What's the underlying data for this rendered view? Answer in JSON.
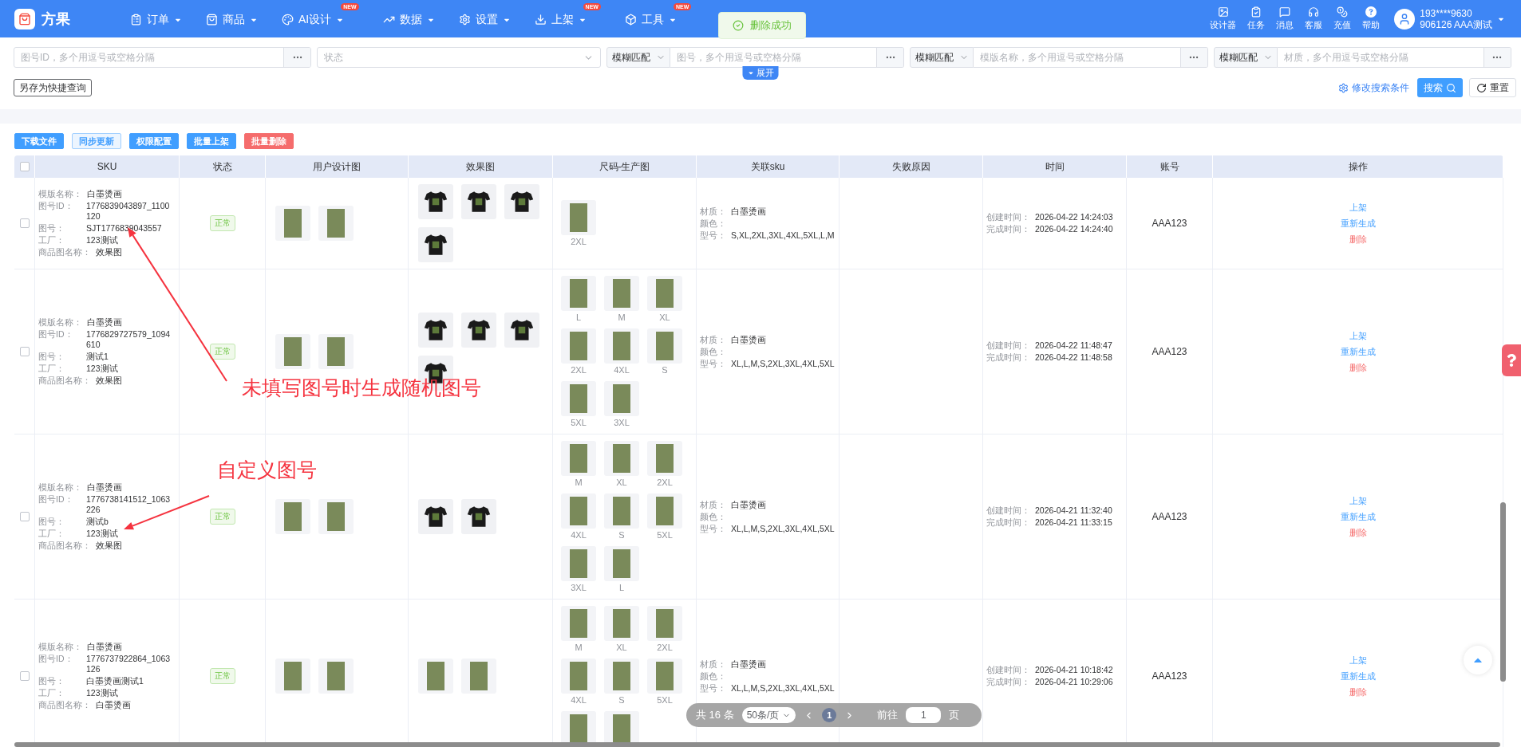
{
  "nav": {
    "logo": "方果",
    "menus": [
      {
        "label": "订单"
      },
      {
        "label": "商品"
      },
      {
        "label": "AI设计",
        "badge": "NEW"
      },
      {
        "label": "数据"
      },
      {
        "label": "设置"
      },
      {
        "label": "上架",
        "badge": "NEW"
      },
      {
        "label": "工具",
        "badge": "NEW"
      }
    ],
    "tools": [
      {
        "label": "设计器"
      },
      {
        "label": "任务"
      },
      {
        "label": "消息"
      },
      {
        "label": "客服"
      },
      {
        "label": "充值"
      },
      {
        "label": "帮助"
      }
    ],
    "user": {
      "phone": "193****9630",
      "account": "906126 AAA测试"
    }
  },
  "toast": {
    "text": "删除成功"
  },
  "filters": {
    "id_field": {
      "placeholder": "图号ID，多个用逗号或空格分隔"
    },
    "status_select": {
      "placeholder": "状态"
    },
    "groups": [
      {
        "mode": "模糊匹配",
        "placeholder": "图号，多个用逗号或空格分隔"
      },
      {
        "mode": "模糊匹配",
        "placeholder": "模版名称，多个用逗号或空格分隔"
      },
      {
        "mode": "模糊匹配",
        "placeholder": "材质，多个用逗号或空格分隔"
      }
    ],
    "save_query": "另存为快捷查询",
    "expand": "展开",
    "edit_conditions": "修改搜索条件",
    "search": "搜索",
    "reset": "重置"
  },
  "actions": [
    {
      "label": "下载文件",
      "kind": "primary"
    },
    {
      "label": "同步更新",
      "kind": "plain"
    },
    {
      "label": "权限配置",
      "kind": "primary"
    },
    {
      "label": "批量上架",
      "kind": "primary"
    },
    {
      "label": "批量删除",
      "kind": "danger"
    }
  ],
  "table": {
    "select_all": {
      "checked": false
    },
    "columns": [
      "SKU",
      "状态",
      "用户设计图",
      "效果图",
      "尺码-生产图",
      "关联sku",
      "失败原因",
      "时间",
      "账号",
      "操作"
    ],
    "rows": [
      {
        "checked": false,
        "sku": [
          {
            "label": "模版名称：",
            "value": "白墨烫画"
          },
          {
            "label": "图号ID：",
            "value": "1776839043897_1100120"
          },
          {
            "label": "图号：",
            "value": "SJT1776839043557"
          },
          {
            "label": "工厂：",
            "value": "123测试"
          },
          {
            "label": "商品图名称：",
            "value": "效果图"
          }
        ],
        "status": "正常",
        "design_images": [
          {
            "kind": "photo"
          },
          {
            "kind": "photo"
          }
        ],
        "effect_images": [
          {
            "kind": "tshirt"
          },
          {
            "kind": "tshirt"
          },
          {
            "kind": "tshirt"
          },
          {
            "kind": "tshirt"
          }
        ],
        "size_images": [
          {
            "kind": "photo",
            "label": "2XL"
          }
        ],
        "related": [
          {
            "label": "材质：",
            "value": "白墨烫画"
          },
          {
            "label": "颜色："
          },
          {
            "label": "型号：",
            "value": "S,XL,2XL,3XL,4XL,5XL,L,M"
          }
        ],
        "times": [
          {
            "label": "创建时间：",
            "value": "2026-04-22 14:24:03"
          },
          {
            "label": "完成时间：",
            "value": "2026-04-22 14:24:40"
          }
        ],
        "account": "AAA123",
        "ops": [
          {
            "label": "上架",
            "kind": "link"
          },
          {
            "label": "重新生成",
            "kind": "link"
          },
          {
            "label": "删除",
            "kind": "danger"
          }
        ]
      },
      {
        "checked": false,
        "sku": [
          {
            "label": "模版名称：",
            "value": "白墨烫画"
          },
          {
            "label": "图号ID：",
            "value": "1776829727579_1094610"
          },
          {
            "label": "图号：",
            "value": "测试1"
          },
          {
            "label": "工厂：",
            "value": "123测试"
          },
          {
            "label": "商品图名称：",
            "value": "效果图"
          }
        ],
        "status": "正常",
        "design_images": [
          {
            "kind": "photo"
          },
          {
            "kind": "photo"
          }
        ],
        "effect_images": [
          {
            "kind": "tshirt"
          },
          {
            "kind": "tshirt"
          },
          {
            "kind": "tshirt"
          },
          {
            "kind": "tshirt"
          }
        ],
        "size_images": [
          {
            "kind": "photo",
            "label": "L"
          },
          {
            "kind": "photo",
            "label": "M"
          },
          {
            "kind": "photo",
            "label": "XL"
          },
          {
            "kind": "photo",
            "label": "2XL"
          },
          {
            "kind": "photo",
            "label": "4XL"
          },
          {
            "kind": "photo",
            "label": "S"
          },
          {
            "kind": "photo",
            "label": "5XL"
          },
          {
            "kind": "photo",
            "label": "3XL"
          }
        ],
        "related": [
          {
            "label": "材质：",
            "value": "白墨烫画"
          },
          {
            "label": "颜色："
          },
          {
            "label": "型号：",
            "value": "XL,L,M,S,2XL,3XL,4XL,5XL"
          }
        ],
        "times": [
          {
            "label": "创建时间：",
            "value": "2026-04-22 11:48:47"
          },
          {
            "label": "完成时间：",
            "value": "2026-04-22 11:48:58"
          }
        ],
        "account": "AAA123",
        "ops": [
          {
            "label": "上架",
            "kind": "link"
          },
          {
            "label": "重新生成",
            "kind": "link"
          },
          {
            "label": "删除",
            "kind": "danger"
          }
        ]
      },
      {
        "checked": false,
        "sku": [
          {
            "label": "模版名称：",
            "value": "白墨烫画"
          },
          {
            "label": "图号ID：",
            "value": "1776738141512_1063226"
          },
          {
            "label": "图号：",
            "value": "测试b"
          },
          {
            "label": "工厂：",
            "value": "123测试"
          },
          {
            "label": "商品图名称：",
            "value": "效果图"
          }
        ],
        "status": "正常",
        "design_images": [
          {
            "kind": "photo"
          },
          {
            "kind": "photo"
          }
        ],
        "effect_images": [
          {
            "kind": "tshirt"
          },
          {
            "kind": "tshirt"
          }
        ],
        "size_images": [
          {
            "kind": "photo",
            "label": "M"
          },
          {
            "kind": "photo",
            "label": "XL"
          },
          {
            "kind": "photo",
            "label": "2XL"
          },
          {
            "kind": "photo",
            "label": "4XL"
          },
          {
            "kind": "photo",
            "label": "S"
          },
          {
            "kind": "photo",
            "label": "5XL"
          },
          {
            "kind": "photo",
            "label": "3XL"
          },
          {
            "kind": "photo",
            "label": "L"
          }
        ],
        "related": [
          {
            "label": "材质：",
            "value": "白墨烫画"
          },
          {
            "label": "颜色："
          },
          {
            "label": "型号：",
            "value": "XL,L,M,S,2XL,3XL,4XL,5XL"
          }
        ],
        "times": [
          {
            "label": "创建时间：",
            "value": "2026-04-21 11:32:40"
          },
          {
            "label": "完成时间：",
            "value": "2026-04-21 11:33:15"
          }
        ],
        "account": "AAA123",
        "ops": [
          {
            "label": "上架",
            "kind": "link"
          },
          {
            "label": "重新生成",
            "kind": "link"
          },
          {
            "label": "删除",
            "kind": "danger"
          }
        ]
      },
      {
        "checked": false,
        "sku": [
          {
            "label": "模版名称：",
            "value": "白墨烫画"
          },
          {
            "label": "图号ID：",
            "value": "1776737922864_1063126"
          },
          {
            "label": "图号：",
            "value": "白墨烫画测试1"
          },
          {
            "label": "工厂：",
            "value": "123测试"
          },
          {
            "label": "商品图名称：",
            "value": "白墨烫画"
          }
        ],
        "status": "正常",
        "design_images": [
          {
            "kind": "photo"
          },
          {
            "kind": "photo"
          }
        ],
        "effect_images": [
          {
            "kind": "photo"
          },
          {
            "kind": "photo"
          }
        ],
        "size_images": [
          {
            "kind": "photo",
            "label": "M"
          },
          {
            "kind": "photo",
            "label": "XL"
          },
          {
            "kind": "photo",
            "label": "2XL"
          },
          {
            "kind": "photo",
            "label": "4XL"
          },
          {
            "kind": "photo",
            "label": "S"
          },
          {
            "kind": "photo",
            "label": "5XL"
          },
          {
            "kind": "photo"
          },
          {
            "kind": "photo"
          }
        ],
        "related": [
          {
            "label": "材质：",
            "value": "白墨烫画"
          },
          {
            "label": "颜色："
          },
          {
            "label": "型号：",
            "value": "XL,L,M,S,2XL,3XL,4XL,5XL"
          }
        ],
        "times": [
          {
            "label": "创建时间：",
            "value": "2026-04-21 10:18:42"
          },
          {
            "label": "完成时间：",
            "value": "2026-04-21 10:29:06"
          }
        ],
        "account": "AAA123",
        "ops": [
          {
            "label": "上架",
            "kind": "link"
          },
          {
            "label": "重新生成",
            "kind": "link"
          },
          {
            "label": "删除",
            "kind": "danger"
          }
        ]
      }
    ]
  },
  "pagination": {
    "total": "共 16 条",
    "page_size": "50条/页",
    "pages": [
      {
        "label": "1",
        "selected": true
      }
    ],
    "goto": "前往",
    "goto_value": "1",
    "goto_suffix": "页"
  },
  "annotations": [
    {
      "text": "未填写图号时生成随机图号"
    },
    {
      "text": "自定义图号"
    }
  ]
}
